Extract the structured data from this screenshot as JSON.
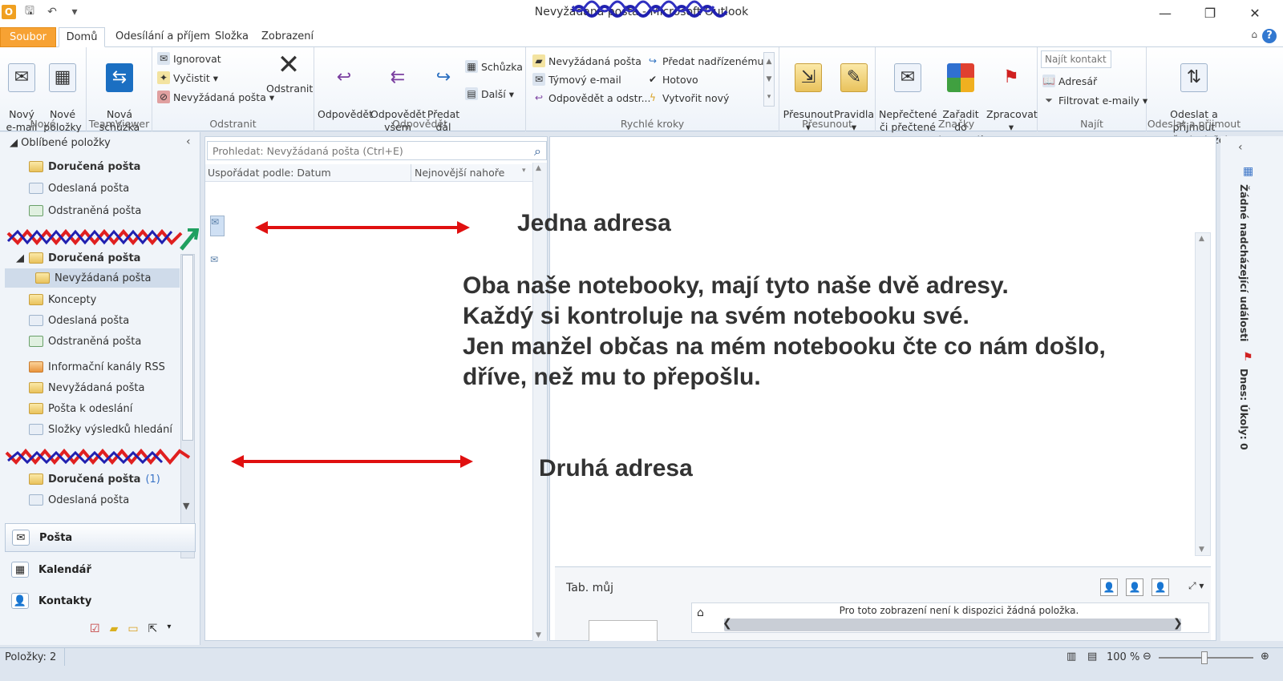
{
  "window": {
    "title": "Nevyžádaná pošta - Microsoft Outlook",
    "controls": [
      "—",
      "❐",
      "✕"
    ]
  },
  "tabs": [
    {
      "label": "Soubor"
    },
    {
      "label": "Domů"
    },
    {
      "label": "Odesílání a příjem"
    },
    {
      "label": "Složka"
    },
    {
      "label": "Zobrazení"
    }
  ],
  "ribbon": {
    "new": {
      "label": "Nové",
      "new_email": "Nový\ne-mail",
      "new_items": "Nové\npoložky ▾"
    },
    "teamviewer": {
      "label": "TeamViewer",
      "meeting": "Nová\nschůzka"
    },
    "delete": {
      "label": "Odstranit",
      "ignore": "Ignorovat",
      "cleanup": "Vyčistit ▾",
      "junk": "Nevyžádaná pošta ▾",
      "delete": "Odstranit"
    },
    "respond": {
      "label": "Odpovědět",
      "reply": "Odpovědět",
      "reply_all": "Odpovědět\nvšem",
      "forward": "Předat\ndál",
      "meeting": "Schůzka",
      "more": "Další ▾"
    },
    "quick": {
      "label": "Rychlé kroky",
      "junk": "Nevyžádaná pošta",
      "team": "Týmový e-mail",
      "reply_del": "Odpovědět a odstr...",
      "manager": "Předat nadřízenému",
      "done": "Hotovo",
      "create": "Vytvořit nový"
    },
    "move": {
      "label": "Přesunout",
      "move": "Přesunout\n▾",
      "rules": "Pravidla\n▾"
    },
    "tags": {
      "label": "Značky",
      "unread": "Nepřečtené\nči přečtené",
      "categorize": "Zařadit do\nkategorií ▾",
      "followup": "Zpracovat\n▾"
    },
    "find": {
      "label": "Najít",
      "contact_placeholder": "Najít kontakt ▾",
      "address_book": "Adresář",
      "filter": "Filtrovat e-maily ▾"
    },
    "sendrecv": {
      "label": "Odeslat a přijmout",
      "all": "Odeslat a přijmout\nu všech složek"
    }
  },
  "nav": {
    "favorites_header": "Oblíbené položky",
    "favorites": [
      {
        "label": "Doručená pošta",
        "bold": true
      },
      {
        "label": "Odeslaná pošta"
      },
      {
        "label": "Odstraněná pošta"
      }
    ],
    "account1": [
      {
        "label": "Doručená pošta",
        "bold": true
      },
      {
        "label": "Nevyžádaná pošta"
      },
      {
        "label": "Koncepty"
      },
      {
        "label": "Odeslaná pošta"
      },
      {
        "label": "Odstraněná pošta"
      },
      {
        "label": "Informační kanály RSS"
      },
      {
        "label": "Nevyžádaná pošta"
      },
      {
        "label": "Pošta k odeslání"
      },
      {
        "label": "Složky výsledků hledání"
      }
    ],
    "account2": [
      {
        "label": "Doručená pošta",
        "bold": true,
        "count": "(1)"
      },
      {
        "label": "Odeslaná pošta"
      }
    ],
    "modules": [
      {
        "label": "Pošta"
      },
      {
        "label": "Kalendář"
      },
      {
        "label": "Kontakty"
      }
    ]
  },
  "list": {
    "search_placeholder": "Prohledat: Nevyžádaná pošta (Ctrl+E)",
    "arrange_by": "Uspořádat podle: Datum",
    "order": "Nejnovější nahoře"
  },
  "annotations": {
    "first": "Jedna adresa",
    "body": [
      "Oba naše  notebooky,  mají  tyto naše dvě adresy.",
      "Každý si kontroluje na svém notebooku své.",
      "Jen manžel občas na mém notebooku čte co nám došlo,",
      "dříve, než mu to přepošlu."
    ],
    "second": "Druhá adresa"
  },
  "people_pane": {
    "name": "Tab. můj",
    "empty": "Pro toto zobrazení není k dispozici žádná položka."
  },
  "todo_bar": {
    "events": "Žádné nadcházející události",
    "tasks": "Dnes: Úkoly: 0"
  },
  "status": {
    "items": "Položky: 2",
    "zoom": "100 %"
  }
}
